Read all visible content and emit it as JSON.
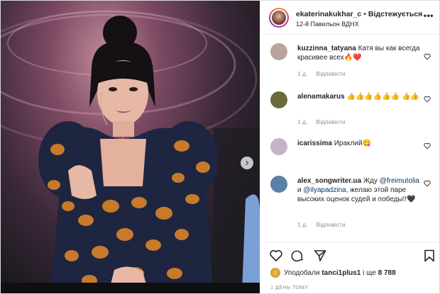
{
  "post": {
    "username": "ekaterinakukhar_c",
    "separator": "•",
    "follow_label": "Відстежується",
    "location": "12-й Павильон ВДНХ",
    "more_label": "•••"
  },
  "comments": [
    {
      "user": "kuzzinna_tatyana",
      "text": "Катя вы как всегда красивее всех🔥❤️",
      "age": "1 д.",
      "reply": "Відповісти",
      "avatar_color": "#b9a39a"
    },
    {
      "user": "alenamakarus",
      "text": "👍👍👍👍👍👍 👍👍",
      "age": "1 д.",
      "reply": "Відповісти",
      "avatar_color": "#6b6b3a"
    },
    {
      "user": "icarissima",
      "text": "Ираклий😋",
      "age": "",
      "reply": "",
      "avatar_color": "#c7b0c9"
    },
    {
      "user": "alex_songwriter.ua",
      "text_prefix": "Жду",
      "mention1": "@freimutolia",
      "text_mid": "и",
      "mention2": "@ilyapadzina",
      "text_suffix": ", желаю этой паре высоких оценок судей и победы!!🖤",
      "age": "1 д.",
      "reply": "Відповісти",
      "avatar_color": "#5b7fa6"
    }
  ],
  "likes": {
    "prefix": "Уподобали",
    "user": "tanci1plus1",
    "mid": "і ще",
    "count": "8 788"
  },
  "timestamp": "1 ДЕНЬ ТОМУ",
  "icons": [
    "heart-icon",
    "comment-icon",
    "share-icon",
    "bookmark-icon",
    "chevron-right-icon"
  ],
  "colors": {
    "link": "#00376b",
    "muted": "#8e8e8e",
    "text": "#262626"
  }
}
